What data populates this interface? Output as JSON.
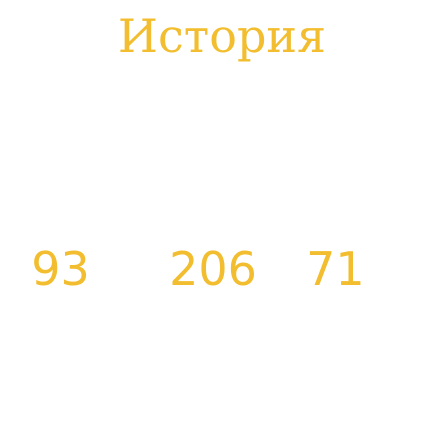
{
  "colors": {
    "background": "#ffffff",
    "text": "#f2bd2e"
  },
  "title": "История",
  "stats": [
    "93",
    "206",
    "71"
  ]
}
